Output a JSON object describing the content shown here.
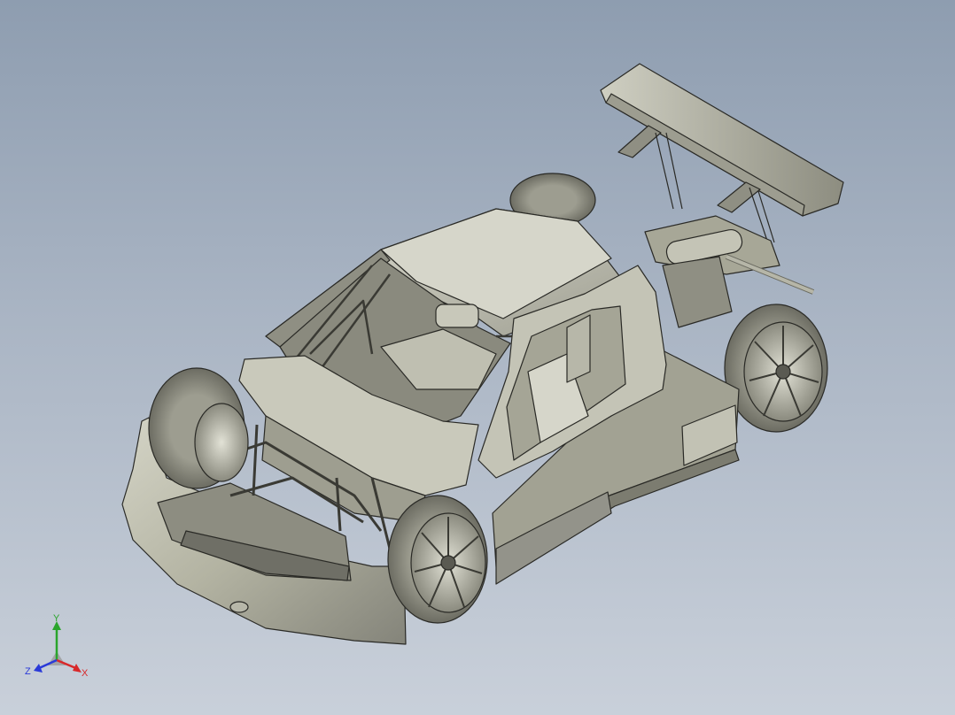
{
  "viewport": {
    "background_top": "#8e9db0",
    "background_bottom": "#c9d0da"
  },
  "model": {
    "body_color": "#b9b9a8",
    "body_dark": "#7f7f72",
    "line_color": "#2a2a26"
  },
  "triad": {
    "x_label": "X",
    "y_label": "Y",
    "z_label": "Z",
    "x_color": "#d8282a",
    "y_color": "#2aa52c",
    "z_color": "#2a3ad8"
  }
}
